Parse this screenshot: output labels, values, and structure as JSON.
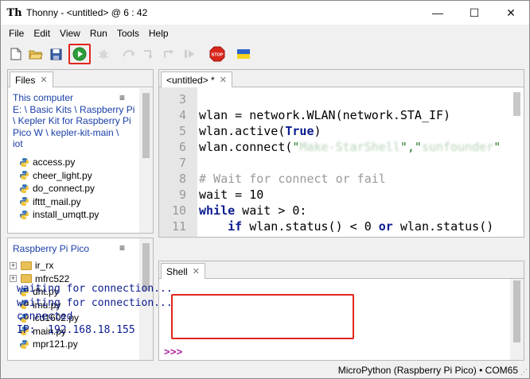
{
  "window": {
    "title": "Thonny  -  <untitled>  @  6 : 42"
  },
  "menu": [
    "File",
    "Edit",
    "View",
    "Run",
    "Tools",
    "Help"
  ],
  "toolbar": {
    "icons": [
      "new-file",
      "open-file",
      "save",
      "run",
      "debug",
      "step-over",
      "step-into",
      "step-out",
      "resume",
      "stop",
      "ukraine-flag"
    ],
    "stop_label": "STOP",
    "highlight_color": "#e0261b"
  },
  "files": {
    "tab_label": "Files",
    "computer": {
      "header_lines": [
        "This computer",
        "E: \\ Basic Kits \\ Raspberry Pi",
        "\\ Kepler Kit for Raspberry Pi",
        "Pico W \\ kepler-kit-main \\",
        "iot"
      ],
      "items": [
        "access.py",
        "cheer_light.py",
        "do_connect.py",
        "ifttt_mail.py",
        "install_umqtt.py"
      ]
    },
    "pico": {
      "header": "Raspberry Pi Pico",
      "folders": [
        "ir_rx",
        "mfrc522"
      ],
      "items": [
        "dht.py",
        "imu.py",
        "lcd1602.py",
        "main.py",
        "mpr121.py"
      ]
    }
  },
  "editor": {
    "tab_label": "<untitled> *",
    "lines": [
      {
        "n": "3",
        "segments": []
      },
      {
        "n": "4",
        "segments": [
          {
            "t": "wlan = network.WLAN(network.STA_IF)",
            "c": ""
          }
        ]
      },
      {
        "n": "5",
        "segments": [
          {
            "t": "wlan.active(",
            "c": ""
          },
          {
            "t": "True",
            "c": "kw"
          },
          {
            "t": ")",
            "c": ""
          }
        ]
      },
      {
        "n": "6",
        "segments": [
          {
            "t": "wlan.connect(",
            "c": ""
          },
          {
            "t": "\"",
            "c": "str"
          },
          {
            "t": "Make-StarShell",
            "c": "blur"
          },
          {
            "t": "\",\"",
            "c": "str"
          },
          {
            "t": "sunfounder",
            "c": "blur"
          },
          {
            "t": "\"",
            "c": "str"
          }
        ]
      },
      {
        "n": "7",
        "segments": []
      },
      {
        "n": "8",
        "segments": [
          {
            "t": "# Wait for connect or fail",
            "c": "cmt"
          }
        ]
      },
      {
        "n": "9",
        "segments": [
          {
            "t": "wait = 10",
            "c": ""
          }
        ]
      },
      {
        "n": "10",
        "segments": [
          {
            "t": "while",
            "c": "kw"
          },
          {
            "t": " wait > 0:",
            "c": ""
          }
        ]
      },
      {
        "n": "11",
        "segments": [
          {
            "t": "    ",
            "c": ""
          },
          {
            "t": "if",
            "c": "kw"
          },
          {
            "t": " wlan.status() < 0 ",
            "c": ""
          },
          {
            "t": "or",
            "c": "kw"
          },
          {
            "t": " wlan.status()",
            "c": ""
          }
        ]
      }
    ]
  },
  "shell": {
    "tab_label": "Shell",
    "lines": [
      "waiting for connection...",
      "waiting for connection...",
      "connected",
      "IP:  192.168.18.155"
    ],
    "prompt": ">>>"
  },
  "status": {
    "text": "MicroPython (Raspberry Pi Pico)  •  COM65"
  }
}
